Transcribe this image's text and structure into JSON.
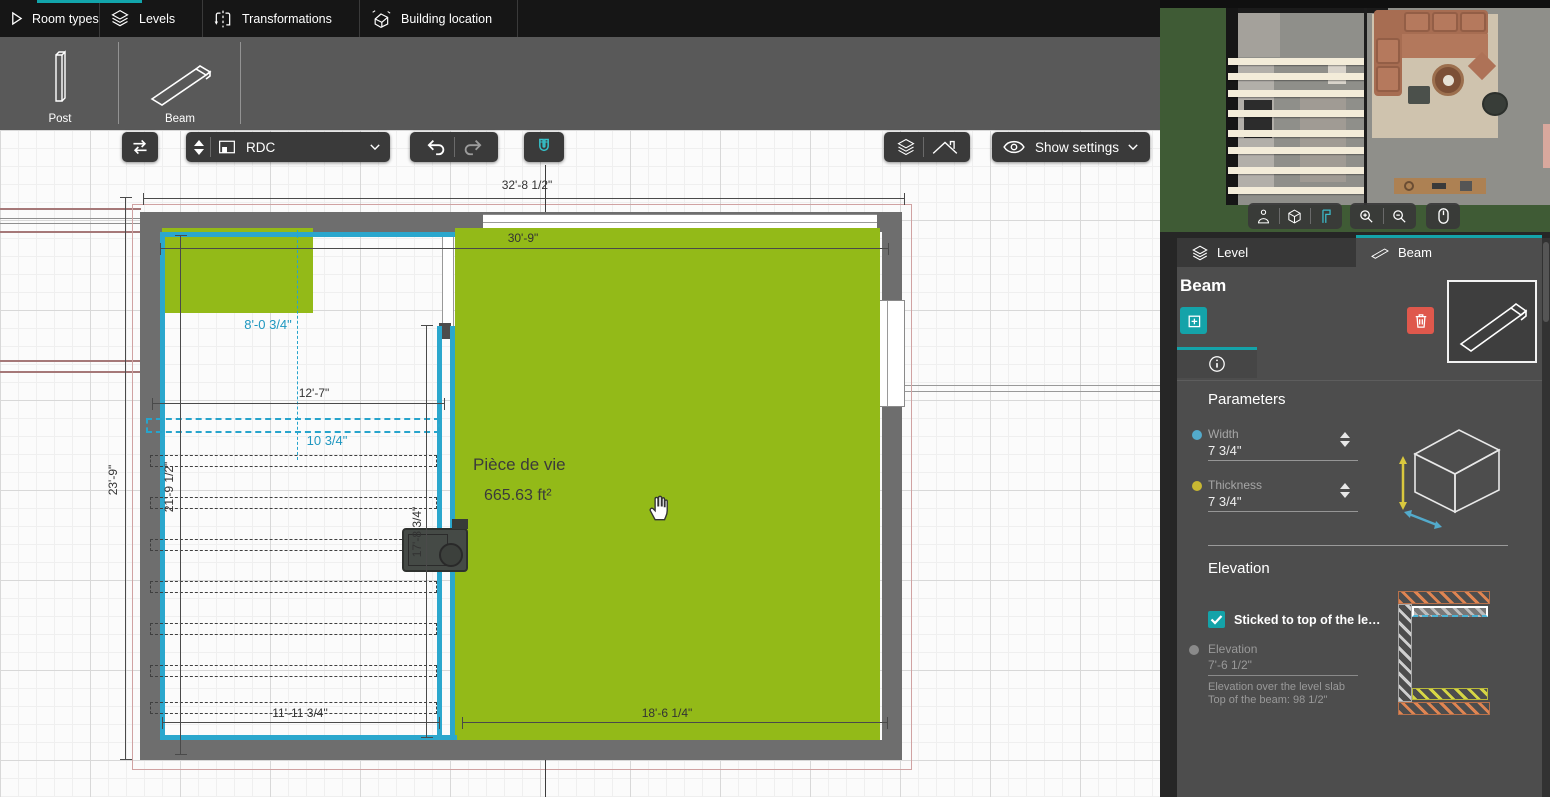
{
  "ribbon": {
    "tabs": [
      {
        "label": "Room types",
        "icon": "play-icon"
      },
      {
        "label": "Levels",
        "icon": "layers-icon",
        "active": true
      },
      {
        "label": "Transformations",
        "icon": "flip-icon"
      },
      {
        "label": "Building location",
        "icon": "building-icon"
      }
    ],
    "tools": [
      {
        "label": "Post",
        "icon": "post-icon"
      },
      {
        "label": "Beam",
        "icon": "beam-icon"
      }
    ]
  },
  "toolbar": {
    "level_selector": {
      "value": "RDC",
      "icon": "floor-icon"
    },
    "show_settings": {
      "label": "Show settings",
      "icon": "eye-icon"
    }
  },
  "canvas": {
    "room": {
      "name": "Pièce de vie",
      "area": "665.63 ft²"
    },
    "dims": {
      "overall_w": "32'-8 1/2\"",
      "inner_w": "30'-9\"",
      "outer_h": "23'-9\"",
      "inner_h": "21'-9 1/2\"",
      "kitchen_w": "12'-7\"",
      "beam_offset": "8'-0 3/4\"",
      "beam_width": "10 3/4\"",
      "living_h": "17'-8 3/4\"",
      "kitchen_bottom_w": "11'-11 3/4\"",
      "living_bottom_w": "18'-6 1/4\""
    }
  },
  "panel": {
    "tabs": [
      {
        "label": "Level",
        "icon": "layers-icon"
      },
      {
        "label": "Beam",
        "icon": "beam-icon",
        "active": true
      }
    ],
    "title": "Beam",
    "parameters": {
      "heading": "Parameters",
      "width_label": "Width",
      "width_value": "7 3/4\"",
      "thickness_label": "Thickness",
      "thickness_value": "7 3/4\""
    },
    "elevation": {
      "heading": "Elevation",
      "sticked_label": "Sticked to top of the le…",
      "label": "Elevation",
      "value": "7'-6 1/2\"",
      "help1": "Elevation over the level slab",
      "help2": "Top of the beam: 98 1/2\""
    }
  },
  "colors": {
    "accent_teal": "#14a3a9",
    "selection_cyan": "#27a4cc",
    "room_green": "#93ba18",
    "delete_red": "#df584c",
    "width_dot_blue": "#53aacb",
    "thickness_dot_yellow": "#c9b832"
  }
}
